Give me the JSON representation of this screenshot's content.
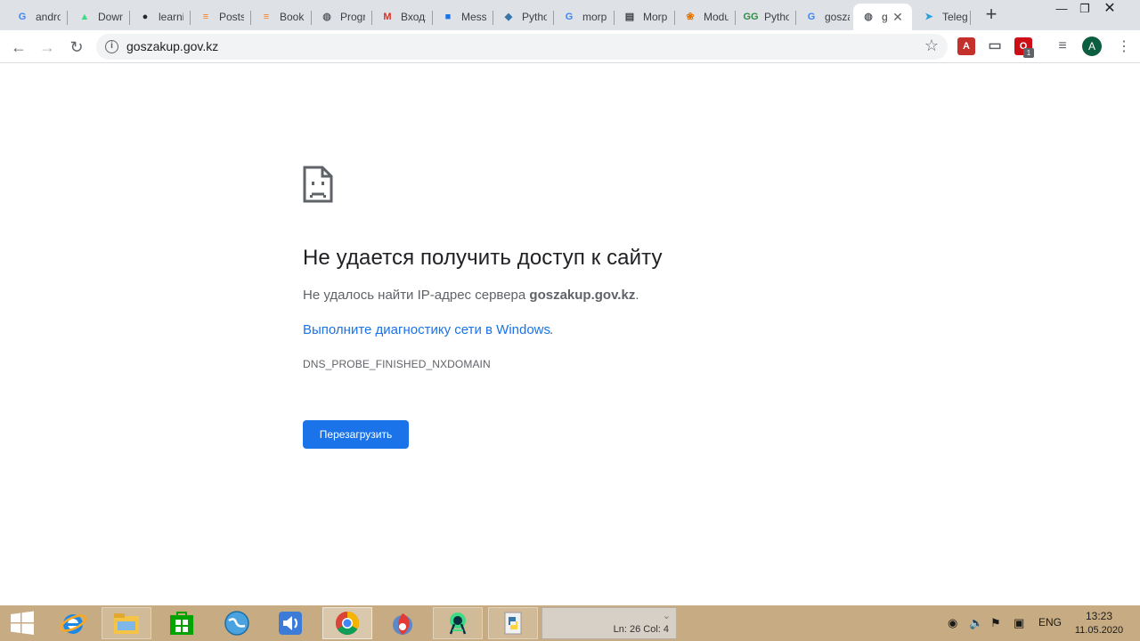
{
  "tabs": [
    {
      "title": "andro",
      "icon": "google-icon",
      "color": "#4285f4"
    },
    {
      "title": "Down",
      "icon": "android-icon",
      "color": "#3ddc84"
    },
    {
      "title": "learni",
      "icon": "github-icon",
      "color": "#24292e"
    },
    {
      "title": "Posts",
      "icon": "stackoverflow-icon",
      "color": "#f48024"
    },
    {
      "title": "Book",
      "icon": "stackoverflow-icon",
      "color": "#f48024"
    },
    {
      "title": "Progr",
      "icon": "globe-icon",
      "color": "#5f6368"
    },
    {
      "title": "Входя",
      "icon": "gmail-icon",
      "color": "#d93025"
    },
    {
      "title": "Mess",
      "icon": "messenger-icon",
      "color": "#1a73e8"
    },
    {
      "title": "Pytho",
      "icon": "python-icon",
      "color": "#3776ab"
    },
    {
      "title": "morp",
      "icon": "google-icon",
      "color": "#4285f4"
    },
    {
      "title": "Morp",
      "icon": "document-icon",
      "color": "#3c4043"
    },
    {
      "title": "Modu",
      "icon": "module-icon",
      "color": "#e37400"
    },
    {
      "title": "Pytho",
      "icon": "gfg-icon",
      "color": "#2f8d46"
    },
    {
      "title": "gosza",
      "icon": "google-icon",
      "color": "#4285f4"
    },
    {
      "title": "g",
      "icon": "globe-icon",
      "color": "#5f6368"
    },
    {
      "title": "Teleg",
      "icon": "telegram-icon",
      "color": "#2aa1da"
    }
  ],
  "address_bar": {
    "url": "goszakup.gov.kz"
  },
  "extensions": [
    {
      "name": "acrobat-extension-icon",
      "color": "#c4302b",
      "glyph": "A"
    },
    {
      "name": "cast-extension-icon",
      "color": "#5f6368",
      "glyph": "▭"
    },
    {
      "name": "opera-extension-icon",
      "color": "#cc0f16",
      "glyph": "O",
      "badge": "1"
    },
    {
      "name": "media-control-icon",
      "color": "#5f6368",
      "glyph": "≡"
    }
  ],
  "profile": {
    "initial": "A",
    "color": "#0b5e3f"
  },
  "error": {
    "title": "Не удается получить доступ к сайту",
    "desc_prefix": "Не удалось найти IP-адрес сервера ",
    "desc_host": "goszakup.gov.kz",
    "desc_suffix": ".",
    "diag_link": "Выполните диагностику сети в Windows",
    "diag_suffix": ".",
    "code": "DNS_PROBE_FINISHED_NXDOMAIN",
    "reload_label": "Перезагрузить"
  },
  "taskbar": {
    "apps": [
      {
        "name": "windows-start-icon"
      },
      {
        "name": "internet-explorer-icon"
      },
      {
        "name": "file-explorer-icon"
      },
      {
        "name": "windows-store-icon"
      },
      {
        "name": "globe-app-icon"
      },
      {
        "name": "speaker-app-icon"
      },
      {
        "name": "chrome-icon"
      },
      {
        "name": "yandex-browser-icon"
      },
      {
        "name": "android-studio-icon"
      },
      {
        "name": "python-app-icon"
      }
    ],
    "editor_status": "Ln: 26   Col: 4",
    "lang": "ENG",
    "time": "13:23",
    "date": "11.05.2020"
  }
}
